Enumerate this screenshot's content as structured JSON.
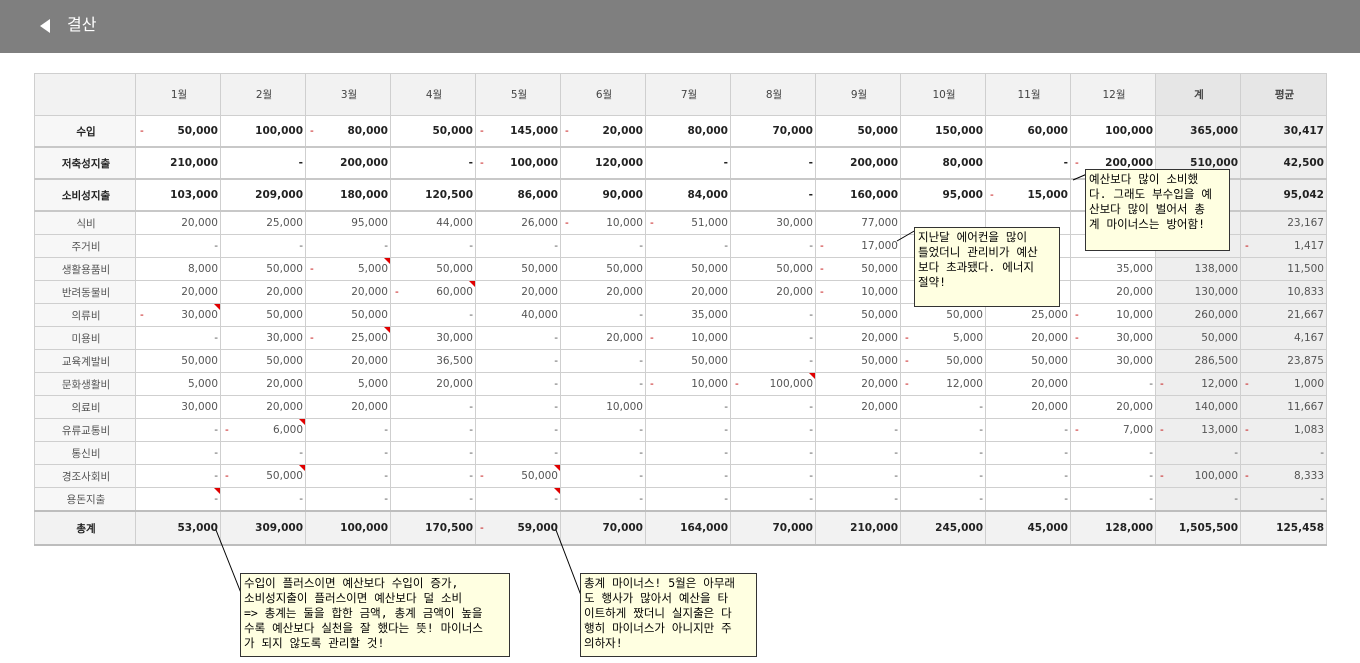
{
  "header": {
    "title": "결산"
  },
  "table": {
    "columns": [
      "",
      "1월",
      "2월",
      "3월",
      "4월",
      "5월",
      "6월",
      "7월",
      "8월",
      "9월",
      "10월",
      "11월",
      "12월",
      "계",
      "평균"
    ],
    "rows": [
      {
        "label": "수입",
        "type": "major",
        "cells": [
          "50,000",
          "100,000",
          "80,000",
          "50,000",
          "145,000",
          "20,000",
          "80,000",
          "70,000",
          "50,000",
          "150,000",
          "60,000",
          "100,000",
          "365,000",
          "30,417"
        ],
        "neg": [
          0,
          2,
          4,
          5
        ]
      },
      {
        "label": "저축성지출",
        "type": "major",
        "cells": [
          "210,000",
          "-",
          "200,000",
          "-",
          "100,000",
          "120,000",
          "-",
          "-",
          "200,000",
          "80,000",
          "-",
          "200,000",
          "510,000",
          "42,500"
        ],
        "neg": [
          4,
          11
        ]
      },
      {
        "label": "소비성지출",
        "type": "major",
        "cells": [
          "103,000",
          "209,000",
          "180,000",
          "120,500",
          "86,000",
          "90,000",
          "84,000",
          "-",
          "160,000",
          "95,000",
          "15,000",
          "",
          "",
          "95,042"
        ],
        "neg": [
          10
        ]
      },
      {
        "label": "식비",
        "type": "sub",
        "cells": [
          "20,000",
          "25,000",
          "95,000",
          "44,000",
          "26,000",
          "10,000",
          "51,000",
          "30,000",
          "77,000",
          "",
          "",
          "",
          "",
          "23,167"
        ],
        "neg": [
          5,
          6
        ]
      },
      {
        "label": "주거비",
        "type": "sub",
        "cells": [
          "-",
          "-",
          "-",
          "-",
          "-",
          "-",
          "-",
          "-",
          "17,000",
          "",
          "",
          "",
          "",
          "1,417"
        ],
        "neg": [
          8,
          13
        ]
      },
      {
        "label": "생활용품비",
        "type": "sub",
        "cells": [
          "8,000",
          "50,000",
          "5,000",
          "50,000",
          "50,000",
          "50,000",
          "50,000",
          "50,000",
          "50,000",
          "",
          "",
          "35,000",
          "138,000",
          "11,500"
        ],
        "neg": [
          2,
          8
        ],
        "flags": [
          2
        ]
      },
      {
        "label": "반려동물비",
        "type": "sub",
        "cells": [
          "20,000",
          "20,000",
          "20,000",
          "60,000",
          "20,000",
          "20,000",
          "20,000",
          "20,000",
          "10,000",
          "",
          "",
          "20,000",
          "130,000",
          "10,833"
        ],
        "neg": [
          3,
          8
        ],
        "flags": [
          3
        ]
      },
      {
        "label": "의류비",
        "type": "sub",
        "cells": [
          "30,000",
          "50,000",
          "50,000",
          "-",
          "40,000",
          "-",
          "35,000",
          "-",
          "50,000",
          "50,000",
          "25,000",
          "10,000",
          "260,000",
          "21,667"
        ],
        "neg": [
          0,
          11
        ],
        "flags": [
          0
        ]
      },
      {
        "label": "미용비",
        "type": "sub",
        "cells": [
          "-",
          "30,000",
          "25,000",
          "30,000",
          "-",
          "20,000",
          "10,000",
          "-",
          "20,000",
          "5,000",
          "20,000",
          "30,000",
          "50,000",
          "4,167"
        ],
        "neg": [
          2,
          6,
          9,
          11
        ],
        "flags": [
          2
        ]
      },
      {
        "label": "교육계발비",
        "type": "sub",
        "cells": [
          "50,000",
          "50,000",
          "20,000",
          "36,500",
          "-",
          "-",
          "50,000",
          "-",
          "50,000",
          "50,000",
          "50,000",
          "30,000",
          "286,500",
          "23,875"
        ],
        "neg": [
          9
        ]
      },
      {
        "label": "문화생활비",
        "type": "sub",
        "cells": [
          "5,000",
          "20,000",
          "5,000",
          "20,000",
          "-",
          "-",
          "10,000",
          "100,000",
          "20,000",
          "12,000",
          "20,000",
          "-",
          "12,000",
          "1,000"
        ],
        "neg": [
          6,
          7,
          9,
          12,
          13
        ],
        "flags": [
          7
        ]
      },
      {
        "label": "의료비",
        "type": "sub",
        "cells": [
          "30,000",
          "20,000",
          "20,000",
          "-",
          "-",
          "10,000",
          "-",
          "-",
          "20,000",
          "-",
          "20,000",
          "20,000",
          "140,000",
          "11,667"
        ],
        "neg": []
      },
      {
        "label": "유류교통비",
        "type": "sub",
        "cells": [
          "-",
          "6,000",
          "-",
          "-",
          "-",
          "-",
          "-",
          "-",
          "-",
          "-",
          "-",
          "7,000",
          "13,000",
          "1,083"
        ],
        "neg": [
          1,
          11,
          12,
          13
        ],
        "flags": [
          1
        ]
      },
      {
        "label": "통신비",
        "type": "sub",
        "cells": [
          "-",
          "-",
          "-",
          "-",
          "-",
          "-",
          "-",
          "-",
          "-",
          "-",
          "-",
          "-",
          "-",
          "-"
        ],
        "neg": []
      },
      {
        "label": "경조사회비",
        "type": "sub",
        "cells": [
          "-",
          "50,000",
          "-",
          "-",
          "50,000",
          "-",
          "-",
          "-",
          "-",
          "-",
          "-",
          "-",
          "100,000",
          "8,333"
        ],
        "neg": [
          1,
          4,
          12,
          13
        ],
        "flags": [
          1,
          4
        ]
      },
      {
        "label": "용돈지출",
        "type": "sub",
        "cells": [
          "-",
          "-",
          "-",
          "-",
          "-",
          "-",
          "-",
          "-",
          "-",
          "-",
          "-",
          "-",
          "-",
          "-"
        ],
        "neg": [],
        "flags": [
          0,
          4
        ]
      },
      {
        "label": "총계",
        "type": "total",
        "cells": [
          "53,000",
          "309,000",
          "100,000",
          "170,500",
          "59,000",
          "70,000",
          "164,000",
          "70,000",
          "210,000",
          "245,000",
          "45,000",
          "128,000",
          "1,505,500",
          "125,458"
        ],
        "neg": [
          4
        ]
      }
    ]
  },
  "notes": {
    "overspend": "예산보다 많이 소비했\n다. 그래도 부수입을 예\n산보다 많이 벌어서 총\n계 마이너스는 방어함!",
    "aircon": "지난달 에어컨을 많이\n틀었더니 관리비가 예산\n보다 초과됐다. 에너지\n절약!",
    "explain": "수입이 플러스이면 예산보다 수입이 증가,\n소비성지출이 플러스이면 예산보다 덜 소비\n=> 총계는 둘을 합한 금액, 총계 금액이 높을\n수록 예산보다 실천을 잘 했다는 뜻! 마이너스\n가 되지 않도록 관리할 것!",
    "may": "총계 마이너스! 5월은 아무래\n도 행사가 많아서 예산을 타\n이트하게 짰더니 실지출은 다\n행히 마이너스가 아니지만 주\n의하자!"
  },
  "colors": {
    "header_bg": "#7f7f7f",
    "negative": "#c00000",
    "note_bg": "#ffffe1"
  }
}
